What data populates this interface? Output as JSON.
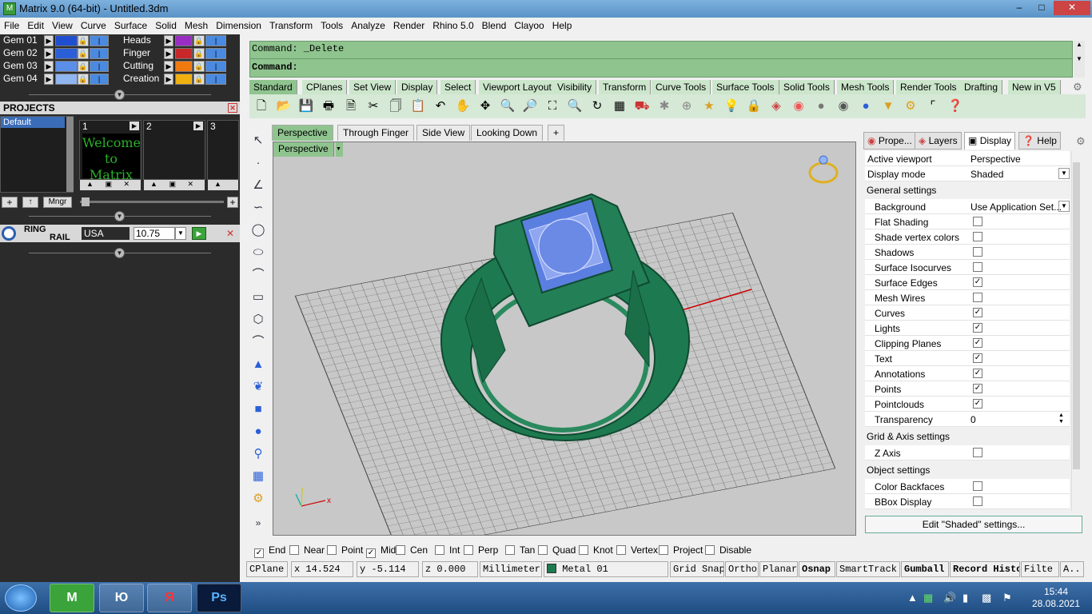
{
  "window": {
    "title": "Matrix 9.0 (64-bit) - Untitled.3dm"
  },
  "menu": [
    "File",
    "Edit",
    "View",
    "Curve",
    "Surface",
    "Solid",
    "Mesh",
    "Dimension",
    "Transform",
    "Tools",
    "Analyze",
    "Render",
    "Rhino 5.0",
    "Blend",
    "Clayoo",
    "Help"
  ],
  "layers_left": [
    {
      "label": "Gem 01",
      "color": "#1f4fd0"
    },
    {
      "label": "Gem 02",
      "color": "#2a5fd8"
    },
    {
      "label": "Gem 03",
      "color": "#5b8ee8"
    },
    {
      "label": "Gem 04",
      "color": "#8fb6f0"
    }
  ],
  "layers_right": [
    {
      "label": "Heads",
      "color": "#9a2ec4"
    },
    {
      "label": "Finger",
      "color": "#c8282a"
    },
    {
      "label": "Cutting",
      "color": "#f07a10"
    },
    {
      "label": "Creation",
      "color": "#f0b010"
    }
  ],
  "projects": {
    "title": "PROJECTS",
    "default_label": "Default",
    "slots": [
      "1",
      "2",
      "3"
    ],
    "welcome_text": "Welcome to Matrix",
    "mngr_label": "Mngr"
  },
  "ring_rail": {
    "label_1": "RING",
    "label_2": "RAIL",
    "standard": "USA",
    "size": "10.75"
  },
  "command": {
    "history": "Command: _Delete",
    "prompt": "Command:"
  },
  "tool_tabs": [
    "Standard",
    "CPlanes",
    "Set View",
    "Display",
    "Select",
    "Viewport Layout",
    "Visibility",
    "Transform",
    "Curve Tools",
    "Surface Tools",
    "Solid Tools",
    "Mesh Tools",
    "Render Tools",
    "Drafting",
    "New in V5"
  ],
  "viewport_tabs": [
    "Perspective",
    "Through Finger",
    "Side View",
    "Looking Down",
    "+"
  ],
  "viewport": {
    "name": "Perspective"
  },
  "right_panel": {
    "tabs": [
      "Prope...",
      "Layers",
      "Display",
      "Help"
    ],
    "active_viewport_label": "Active viewport",
    "active_viewport_value": "Perspective",
    "display_mode_label": "Display mode",
    "display_mode_value": "Shaded",
    "general_settings": "General settings",
    "background_label": "Background",
    "background_value": "Use Application Set...",
    "settings": [
      {
        "label": "Flat Shading",
        "checked": false
      },
      {
        "label": "Shade vertex colors",
        "checked": false
      },
      {
        "label": "Shadows",
        "checked": false
      },
      {
        "label": "Surface Isocurves",
        "checked": false
      },
      {
        "label": "Surface Edges",
        "checked": true
      },
      {
        "label": "Mesh Wires",
        "checked": false
      },
      {
        "label": "Curves",
        "checked": true
      },
      {
        "label": "Lights",
        "checked": true
      },
      {
        "label": "Clipping Planes",
        "checked": true
      },
      {
        "label": "Text",
        "checked": true
      },
      {
        "label": "Annotations",
        "checked": true
      },
      {
        "label": "Points",
        "checked": true
      },
      {
        "label": "Pointclouds",
        "checked": true
      }
    ],
    "transparency_label": "Transparency",
    "transparency_value": "0",
    "grid_axis": "Grid & Axis settings",
    "z_axis_label": "Z Axis",
    "object_settings": "Object settings",
    "color_backfaces": "Color Backfaces",
    "bbox_display": "BBox Display",
    "edit_button": "Edit \"Shaded\" settings..."
  },
  "osnap": [
    {
      "label": "End",
      "checked": true
    },
    {
      "label": "Near",
      "checked": false
    },
    {
      "label": "Point",
      "checked": false
    },
    {
      "label": "Mid",
      "checked": true
    },
    {
      "label": "Cen",
      "checked": false
    },
    {
      "label": "Int",
      "checked": false
    },
    {
      "label": "Perp",
      "checked": false
    },
    {
      "label": "Tan",
      "checked": false
    },
    {
      "label": "Quad",
      "checked": false
    },
    {
      "label": "Knot",
      "checked": false
    },
    {
      "label": "Vertex",
      "checked": false
    },
    {
      "label": "Project",
      "checked": false
    },
    {
      "label": "Disable",
      "checked": false
    }
  ],
  "status": {
    "cplane": "CPlane",
    "x": "x 14.524",
    "y": "y -5.114",
    "z": "z 0.000",
    "units": "Millimeters",
    "layer": "Metal 01",
    "layer_color": "#1d7a50",
    "grid_snap": "Grid Snap",
    "ortho": "Ortho",
    "planar": "Planar",
    "osnap": "Osnap",
    "smarttrack": "SmartTrack",
    "gumball": "Gumball",
    "record": "Record Histo",
    "filter": "Filte",
    "a": "A.."
  },
  "taskbar": {
    "time": "15:44",
    "date": "28.08.2021",
    "app_ps": "Ps",
    "app_yandex": "Я",
    "app_ju": "Ю"
  }
}
